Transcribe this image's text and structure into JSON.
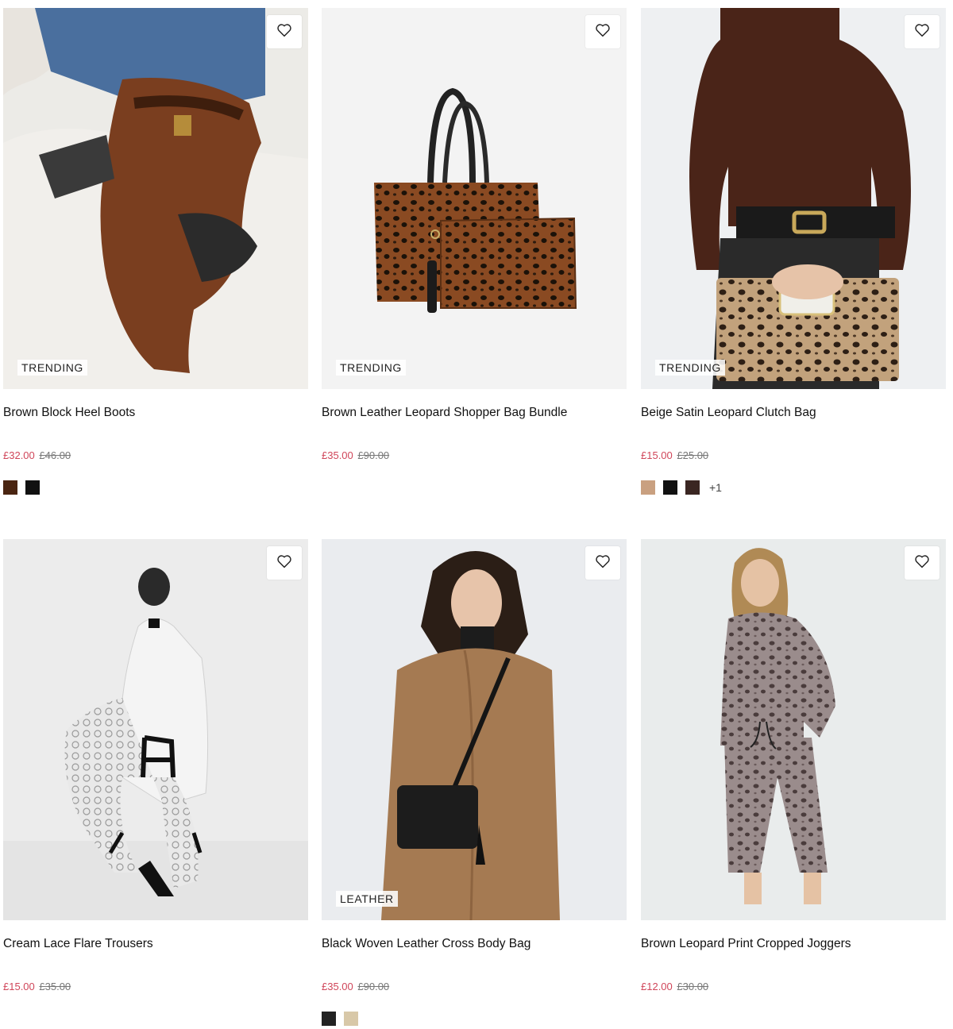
{
  "products": [
    {
      "title": "Brown Block Heel Boots",
      "price_now": "£32.00",
      "price_was": "£46.00",
      "badge": "TRENDING",
      "swatches": [
        "#4a2511",
        "#111111"
      ],
      "more": ""
    },
    {
      "title": "Brown Leather Leopard Shopper Bag Bundle",
      "price_now": "£35.00",
      "price_was": "£90.00",
      "badge": "TRENDING",
      "swatches": [],
      "more": ""
    },
    {
      "title": "Beige Satin Leopard Clutch Bag",
      "price_now": "£15.00",
      "price_was": "£25.00",
      "badge": "TRENDING",
      "swatches": [
        "#c9a080",
        "#111111",
        "#3a2622"
      ],
      "more": "+1"
    },
    {
      "title": "Cream Lace Flare Trousers",
      "price_now": "£15.00",
      "price_was": "£35.00",
      "badge": "",
      "swatches": [],
      "more": ""
    },
    {
      "title": "Black Woven Leather Cross Body Bag",
      "price_now": "£35.00",
      "price_was": "£90.00",
      "badge": "LEATHER",
      "swatches": [
        "#222222",
        "#d8c8a8"
      ],
      "more": ""
    },
    {
      "title": "Brown Leopard Print Cropped Joggers",
      "price_now": "£12.00",
      "price_was": "£30.00",
      "badge": "",
      "swatches": [],
      "more": ""
    }
  ]
}
